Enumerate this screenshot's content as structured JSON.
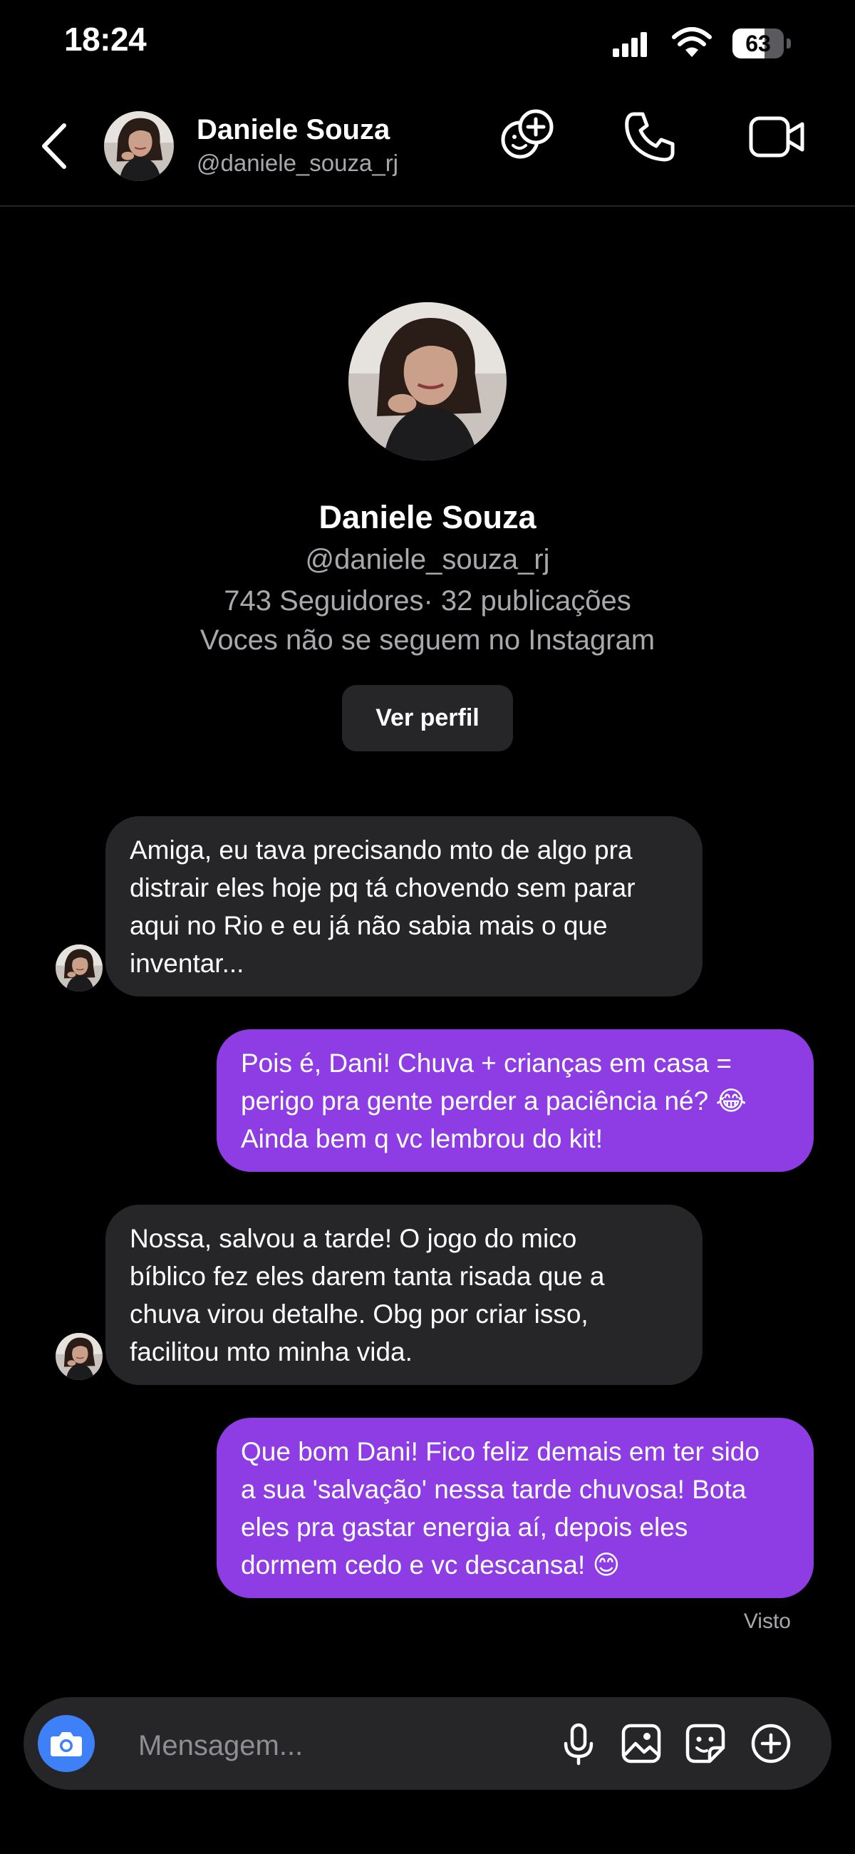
{
  "status_bar": {
    "time": "18:24",
    "battery": "63",
    "battery_level": 0.63
  },
  "header": {
    "name": "Daniele Souza",
    "username": "@daniele_souza_rj",
    "icons": [
      "back-chevron-icon",
      "add-person-icon",
      "phone-icon",
      "video-icon"
    ]
  },
  "profile": {
    "name": "Daniele Souza",
    "username": "@daniele_souza_rj",
    "stats": "743 Seguidores· 32 publicações",
    "follow_status": "Voces não se seguem no Instagram",
    "view_profile_label": "Ver perfil"
  },
  "messages": [
    {
      "from": "them",
      "text": "Amiga, eu tava precisando mto de algo pra\ndistrair eles hoje pq tá chovendo sem parar\naqui no Rio e eu já não sabia mais o que\ninventar..."
    },
    {
      "from": "me",
      "text": "Pois é, Dani! Chuva + crianças em casa =\nperigo pra gente perder a paciência né? 😂\nAinda bem q vc lembrou do kit!"
    },
    {
      "from": "them",
      "text": "Nossa, salvou a tarde! O jogo do mico\nbíblico fez eles darem tanta risada que a\nchuva virou detalhe. Obg por criar isso,\nfacilitou mto minha vida."
    },
    {
      "from": "me",
      "text": "Que bom Dani! Fico feliz demais em ter sido\na sua 'salvação' nessa tarde chuvosa! Bota\neles pra gastar energia aí, depois eles\ndormem cedo e vc descansa! 😊"
    }
  ],
  "seen_label": "Visto",
  "composer": {
    "placeholder": "Mensagem...",
    "icons": [
      "camera-icon",
      "microphone-icon",
      "gallery-icon",
      "sticker-icon",
      "plus-icon"
    ]
  },
  "colors": {
    "background": "#000000",
    "incoming_bubble": "#262629",
    "outgoing_bubble": "#8d3de3",
    "camera_button": "#3e80f7",
    "secondary_text": "#a8a8ad"
  }
}
